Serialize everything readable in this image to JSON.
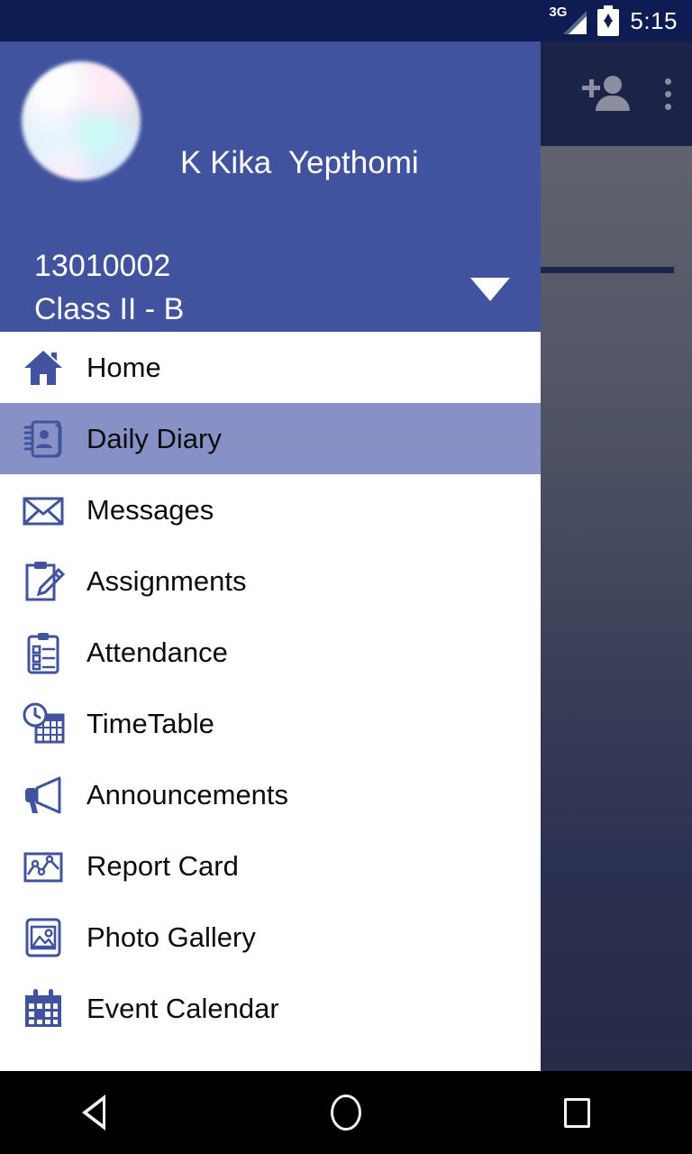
{
  "statusbar": {
    "network_label": "3G",
    "time": "5:15",
    "signal_icon": "signal-triangle-icon",
    "battery_icon": "battery-charging-icon"
  },
  "background_app": {
    "toolbar": {
      "add_person_icon": "add-person-icon",
      "overflow_icon": "overflow-menu-icon"
    }
  },
  "drawer": {
    "profile": {
      "avatar_icon": "avatar-image",
      "name": "K Kika  Yepthomi",
      "id": "13010002",
      "class": "Class II - B",
      "dropdown_icon": "chevron-down-icon"
    },
    "menu_items": [
      {
        "label": "Home",
        "icon": "home-icon",
        "selected": false
      },
      {
        "label": "Daily Diary",
        "icon": "diary-book-icon",
        "selected": true
      },
      {
        "label": "Messages",
        "icon": "envelope-icon",
        "selected": false
      },
      {
        "label": "Assignments",
        "icon": "clipboard-pencil-icon",
        "selected": false
      },
      {
        "label": "Attendance",
        "icon": "clipboard-check-icon",
        "selected": false
      },
      {
        "label": "TimeTable",
        "icon": "clock-calendar-icon",
        "selected": false
      },
      {
        "label": "Announcements",
        "icon": "megaphone-icon",
        "selected": false
      },
      {
        "label": "Report Card",
        "icon": "chart-card-icon",
        "selected": false
      },
      {
        "label": "Photo Gallery",
        "icon": "photo-image-icon",
        "selected": false
      },
      {
        "label": "Event Calendar",
        "icon": "calendar-icon",
        "selected": false
      }
    ]
  },
  "navbar": {
    "back_icon": "back-triangle-icon",
    "home_icon": "home-circle-icon",
    "recents_icon": "recents-square-icon"
  },
  "colors": {
    "statusbar_bg": "#0d1c52",
    "drawer_header_bg": "#41539E",
    "selected_item_bg": "#8791C6",
    "icon_blue": "#41539E",
    "toolbar_bg": "#1b2448"
  }
}
